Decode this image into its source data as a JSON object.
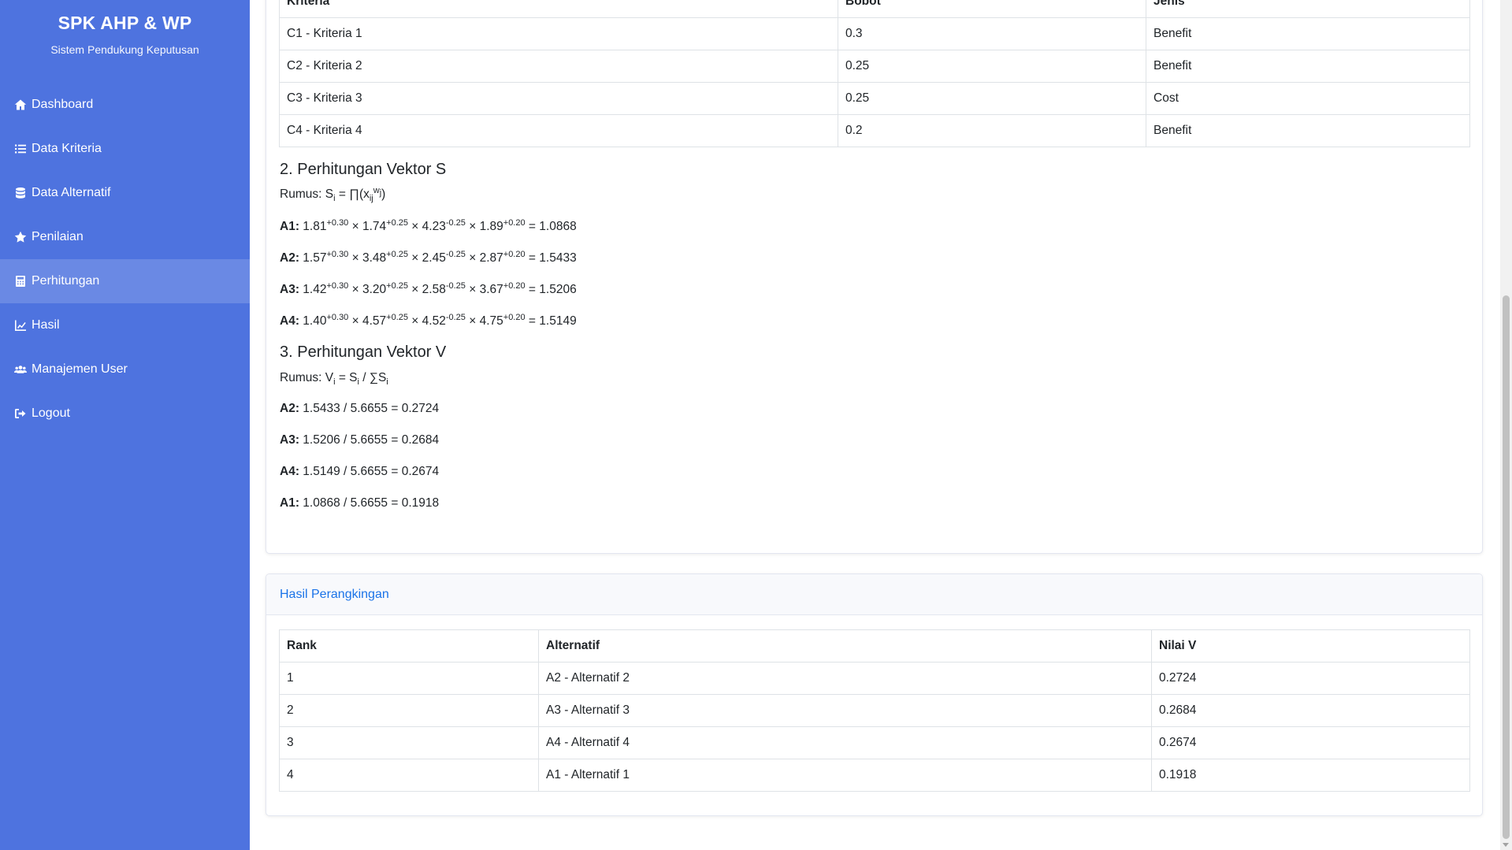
{
  "brand": {
    "title": "SPK AHP & WP",
    "subtitle": "Sistem Pendukung Keputusan"
  },
  "nav": [
    {
      "label": "Dashboard",
      "icon": "home-icon"
    },
    {
      "label": "Data Kriteria",
      "icon": "list-icon"
    },
    {
      "label": "Data Alternatif",
      "icon": "database-icon"
    },
    {
      "label": "Penilaian",
      "icon": "star-icon"
    },
    {
      "label": "Perhitungan",
      "icon": "calculator-icon",
      "active": true
    },
    {
      "label": "Hasil",
      "icon": "chart-line-icon"
    },
    {
      "label": "Manajemen User",
      "icon": "users-icon"
    },
    {
      "label": "Logout",
      "icon": "sign-out-icon"
    }
  ],
  "kriteria_table": {
    "headers": [
      "Kriteria",
      "Bobot",
      "Jenis"
    ],
    "rows": [
      [
        "C1 - Kriteria 1",
        "0.3",
        "Benefit"
      ],
      [
        "C2 - Kriteria 2",
        "0.25",
        "Benefit"
      ],
      [
        "C3 - Kriteria 3",
        "0.25",
        "Cost"
      ],
      [
        "C4 - Kriteria 4",
        "0.2",
        "Benefit"
      ]
    ]
  },
  "vektor_s": {
    "title": "2. Perhitungan Vektor S",
    "formula_prefix": "Rumus: S",
    "formula_sub": "i",
    "formula_mid": " = ∏(x",
    "formula_sub2": "ij",
    "formula_sup": "w",
    "formula_sup_sub": "j",
    "formula_end": ")",
    "rows": [
      {
        "label": "A1:",
        "terms": [
          [
            "1.81",
            "+0.30"
          ],
          [
            "1.74",
            "+0.25"
          ],
          [
            "4.23",
            "-0.25"
          ],
          [
            "1.89",
            "+0.20"
          ]
        ],
        "result": "1.0868"
      },
      {
        "label": "A2:",
        "terms": [
          [
            "1.57",
            "+0.30"
          ],
          [
            "3.48",
            "+0.25"
          ],
          [
            "2.45",
            "-0.25"
          ],
          [
            "2.87",
            "+0.20"
          ]
        ],
        "result": "1.5433"
      },
      {
        "label": "A3:",
        "terms": [
          [
            "1.42",
            "+0.30"
          ],
          [
            "3.20",
            "+0.25"
          ],
          [
            "2.58",
            "-0.25"
          ],
          [
            "3.67",
            "+0.20"
          ]
        ],
        "result": "1.5206"
      },
      {
        "label": "A4:",
        "terms": [
          [
            "1.40",
            "+0.30"
          ],
          [
            "4.57",
            "+0.25"
          ],
          [
            "4.52",
            "-0.25"
          ],
          [
            "4.75",
            "+0.20"
          ]
        ],
        "result": "1.5149"
      }
    ]
  },
  "vektor_v": {
    "title": "3. Perhitungan Vektor V",
    "formula_prefix": "Rumus: V",
    "formula_sub": "i",
    "formula_mid": " = S",
    "formula_sub2": "i",
    "formula_mid2": " / ∑S",
    "formula_sub3": "i",
    "rows": [
      {
        "label": "A2:",
        "text": "1.5433 / 5.6655 = 0.2724"
      },
      {
        "label": "A3:",
        "text": "1.5206 / 5.6655 = 0.2684"
      },
      {
        "label": "A4:",
        "text": "1.5149 / 5.6655 = 0.2674"
      },
      {
        "label": "A1:",
        "text": "1.0868 / 5.6655 = 0.1918"
      }
    ]
  },
  "ranking": {
    "title": "Hasil Perangkingan",
    "headers": [
      "Rank",
      "Alternatif",
      "Nilai V"
    ],
    "rows": [
      [
        "1",
        "A2 - Alternatif 2",
        "0.2724"
      ],
      [
        "2",
        "A3 - Alternatif 3",
        "0.2684"
      ],
      [
        "3",
        "A4 - Alternatif 4",
        "0.2674"
      ],
      [
        "4",
        "A1 - Alternatif 1",
        "0.1918"
      ]
    ]
  }
}
